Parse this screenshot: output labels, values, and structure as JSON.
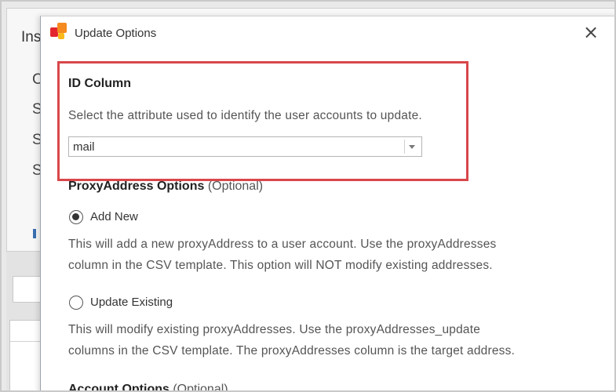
{
  "background_window": {
    "title_fragment": "Ins",
    "line_fragments": [
      "C",
      "S",
      "S",
      "S"
    ]
  },
  "dialog": {
    "title": "Update Options",
    "close_glyph": "×"
  },
  "id_column": {
    "heading": "ID Column",
    "description": "Select the attribute used to identify the user accounts to update.",
    "select_value": "mail"
  },
  "proxy_options": {
    "heading": "ProxyAddress Options",
    "optional": "(Optional)",
    "options": [
      {
        "label": "Add New",
        "checked": true,
        "description_lines": [
          "This will add a new proxyAddress to a user account. Use the proxyAddresses",
          "column in the CSV template. This option will NOT modify existing addresses."
        ]
      },
      {
        "label": "Update Existing",
        "checked": false,
        "description_lines": [
          "This will modify existing proxyAddresses. Use the proxyAddresses_update",
          "columns in the CSV template. The proxyAddresses column is the target address."
        ]
      }
    ]
  },
  "account_options": {
    "heading": "Account Options",
    "optional": "(Optional)"
  },
  "colors": {
    "highlight": "#d9474a",
    "logo_red": "#e3262e",
    "logo_orange": "#f58a1f",
    "logo_yellow": "#fbb91b"
  }
}
